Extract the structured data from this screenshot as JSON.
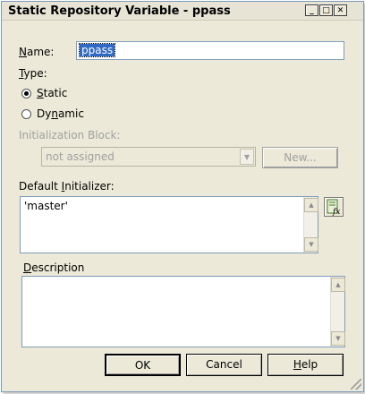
{
  "window": {
    "title": "Static Repository Variable - ppass"
  },
  "title_controls": {
    "minimize": "_",
    "maximize": "□",
    "close": "✕"
  },
  "name": {
    "label_prefix": "",
    "label_underline": "N",
    "label_rest": "ame:",
    "value": "ppass"
  },
  "type": {
    "label_underline": "T",
    "label_rest": "ype:",
    "static_u": "S",
    "static_rest": "tatic",
    "dynamic_pre": "Dy",
    "dynamic_u": "n",
    "dynamic_rest": "amic",
    "selected": "Static"
  },
  "init_block": {
    "label": "Initialization Block:",
    "value": "not assigned",
    "new_button": "New..."
  },
  "default_init": {
    "label_pre": "Default ",
    "label_u": "I",
    "label_rest": "nitializer:",
    "value": "'master'"
  },
  "description": {
    "label_u": "D",
    "label_rest": "escription",
    "value": ""
  },
  "buttons": {
    "ok": "OK",
    "cancel": "Cancel",
    "help_u": "H",
    "help_rest": "elp"
  },
  "colors": {
    "selection": "#316ac5",
    "face": "#ece9d8",
    "border": "#7f9db9"
  }
}
